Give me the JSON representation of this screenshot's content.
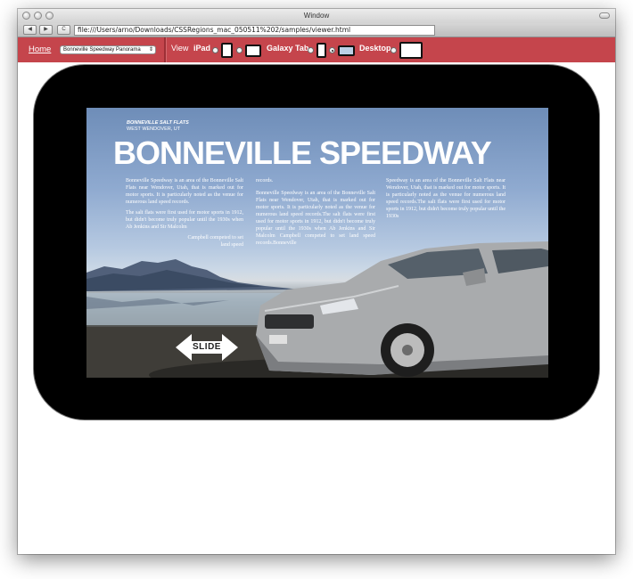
{
  "window": {
    "title": "Window"
  },
  "toolbar": {
    "back_label": "◀",
    "forward_label": "▶",
    "reload_label": "C",
    "url": "file:///Users/arno/Downloads/CSSRegions_mac_050511%202/samples/viewer.html"
  },
  "nav": {
    "home_label": "Home",
    "select_value": "Bonneville Speedway Panorama",
    "select_arrow": "⇕",
    "view_label": "View",
    "ipad_label": "iPad",
    "galaxy_label": "Galaxy Tab",
    "desktop_label": "Desktop"
  },
  "article": {
    "kicker_line1": "BONNEVILLE SALT FLATS",
    "kicker_line2": "WEST WENDOVER, UT",
    "headline": "BONNEVILLE SPEEDWAY",
    "col1_p1": "Bonneville Speedway is an area of the Bonneville Salt Flats near Wendover, Utah, that is marked out for motor sports. It is particularly noted as the venue for numerous land speed records.",
    "col1_p2": "The salt flats were first used for motor sports in 1912, but didn't become truly popular until the 1930s when Ab Jenkins and Sir Malcolm",
    "col1_p3": "Campbell competed to set land speed",
    "col2_p1": "records.",
    "col2_p2": "Bonneville Speedway is an area of the Bonneville Salt Flats near Wendover, Utah, that is marked out for motor sports. It is particularly noted as the venue for numerous land speed records.The salt flats were first used for motor sports in 1912, but didn't become truly popular until the 1930s when Ab Jenkins and Sir Malcolm Campbell competed to set land speed records.Bonneville",
    "col3_p1": "Speedway is an area of the Bonneville Salt Flats near Wendover, Utah, that is marked out for motor sports. It is particularly noted as the venue for numerous land speed records.The salt flats were first used for motor sports in 1912, but didn't become truly popular until the 1930s",
    "slide_label": "SLIDE"
  },
  "colors": {
    "nav_bar": "#c5454c",
    "tablet_bezel": "#000000"
  }
}
